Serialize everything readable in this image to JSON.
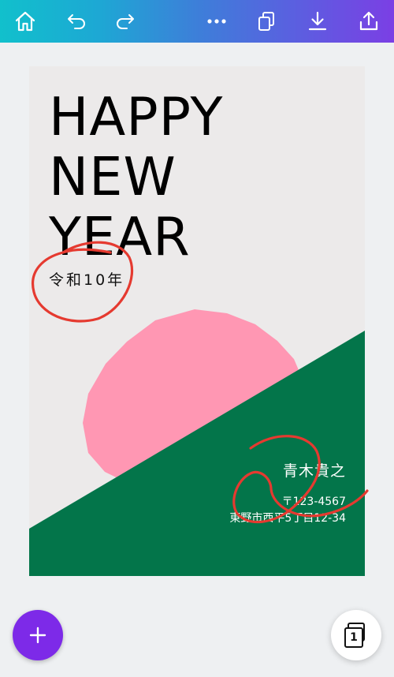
{
  "toolbar": {
    "icons": [
      "home-icon",
      "undo-icon",
      "redo-icon",
      "more-icon",
      "duplicate-icon",
      "download-icon",
      "share-icon"
    ],
    "gradient": [
      "#11c0cc",
      "#7b3fe4"
    ]
  },
  "design": {
    "headline": [
      "HAPPY",
      "NEW",
      "YEAR"
    ],
    "era": "令和10年",
    "sender_name": "青木貴之",
    "postal": "〒123-4567",
    "address": "東野市西平5丁目12-34",
    "colors": {
      "background": "#eceaea",
      "sun": "#ff97b3",
      "hill": "#03754a",
      "text": "#000000"
    }
  },
  "annotations": {
    "color": "#e53a30",
    "marks": [
      "circle",
      "circle-number-2"
    ]
  },
  "fab": {
    "add_icon": "plus-icon",
    "add_color": "#7d2ae8",
    "pages_count": "1"
  }
}
